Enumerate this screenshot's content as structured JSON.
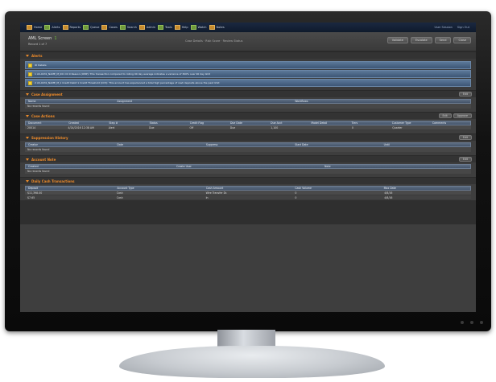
{
  "topbar": {
    "tabs": [
      "Home",
      "Alerts",
      "Reports",
      "Queue",
      "Cases",
      "Search",
      "Admin",
      "Tools",
      "Help",
      "Watch",
      "Notes"
    ],
    "right": [
      "User Session",
      "Sign Out"
    ]
  },
  "header": {
    "title": "AML Screen",
    "badge": "1",
    "subtitle": "Record 1 of 7",
    "tagline": "Case Details · Risk Score · Review Status",
    "buttons": [
      "Validate",
      "Escalate",
      "Send",
      "Close"
    ]
  },
  "alerts_section": {
    "label": "Alerts",
    "rows": [
      {
        "text": "ID   Details"
      },
      {
        "text": "1   AS-0431_NAME_M_001 Cli 9 Reason (OMP): This transaction compared to rolling 90 day average indicates a variance of 300% over 90 day limit"
      },
      {
        "text": "2   AS-0431_NAME_M_1 Credit Debit 1 Credit Threshold (CC5): This account has experienced a total high percentage of cash deposits above the past limit"
      }
    ]
  },
  "case_assignment": {
    "label": "Case Assignment",
    "action": "Edit",
    "columns": [
      "Name",
      "Assignment",
      "",
      "Workflows",
      ""
    ],
    "empty": "No records found"
  },
  "case_actions": {
    "label": "Case Actions",
    "actions": [
      "Edit",
      "Approve"
    ],
    "columns": [
      "Document",
      "Created",
      "Step #",
      "Status",
      "Credit Flag",
      "Due Date",
      "Due Acct",
      "Model Detail",
      "Tiers",
      "Customer Type",
      "Comments"
    ],
    "rows": [
      [
        "20014",
        "4/24/2016 12:38 AM",
        "Alert",
        "Due",
        "Off",
        "Due",
        "1,100",
        "",
        "0",
        "Quarter",
        ""
      ]
    ]
  },
  "suppression_history": {
    "label": "Suppression History",
    "action": "Edit",
    "columns": [
      "Creator",
      "Date",
      "Suppress",
      "Start Date",
      "Until"
    ],
    "empty": "No records found"
  },
  "account_note": {
    "label": "Account Note",
    "action": "Edit",
    "columns": [
      "Created",
      "Create User",
      "Note"
    ],
    "empty": "No records found"
  },
  "daily_cash": {
    "label": "Daily Cash Transactions",
    "columns": [
      "Deposit",
      "Account Type",
      "Cash Amount",
      "Cash Volume",
      "Max Date"
    ],
    "rows": [
      [
        "$11,398.00",
        "Cash",
        "Wire Transfer Dr.",
        "0",
        "4/8/16"
      ],
      [
        "$7.65",
        "Cash",
        "In",
        "0",
        "4/8/16"
      ]
    ]
  }
}
